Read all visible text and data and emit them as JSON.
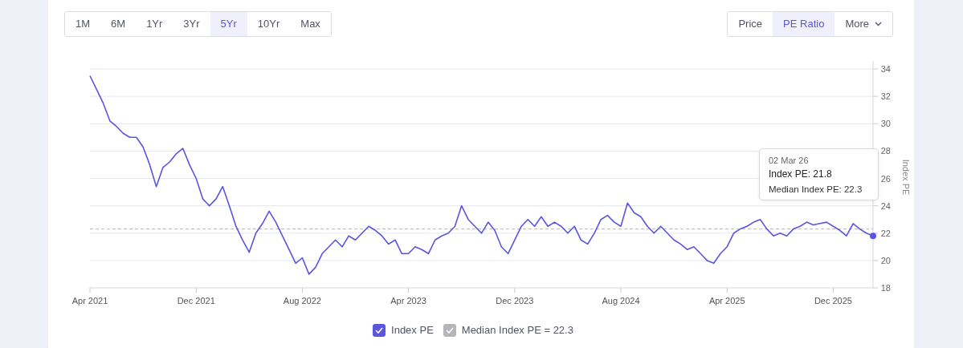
{
  "range_tabs": [
    {
      "label": "1M",
      "selected": false
    },
    {
      "label": "6M",
      "selected": false
    },
    {
      "label": "1Yr",
      "selected": false
    },
    {
      "label": "3Yr",
      "selected": false
    },
    {
      "label": "5Yr",
      "selected": true
    },
    {
      "label": "10Yr",
      "selected": false
    },
    {
      "label": "Max",
      "selected": false
    }
  ],
  "view_tabs": [
    {
      "label": "Price",
      "selected": false,
      "kind": "plain"
    },
    {
      "label": "PE Ratio",
      "selected": true,
      "kind": "plain"
    },
    {
      "label": "More",
      "selected": false,
      "kind": "dropdown"
    }
  ],
  "chart": {
    "chart_data": {
      "type": "line",
      "ylabel": "Index PE",
      "categories": [
        "Apr 2021",
        null,
        null,
        null,
        null,
        null,
        null,
        null,
        null,
        null,
        null,
        null,
        null,
        null,
        null,
        null,
        "Dec 2021",
        null,
        null,
        null,
        null,
        null,
        null,
        null,
        null,
        null,
        null,
        null,
        null,
        null,
        null,
        null,
        "Aug 2022",
        null,
        null,
        null,
        null,
        null,
        null,
        null,
        null,
        null,
        null,
        null,
        null,
        null,
        null,
        null,
        "Apr 2023",
        null,
        null,
        null,
        null,
        null,
        null,
        null,
        null,
        null,
        null,
        null,
        null,
        null,
        null,
        null,
        "Dec 2023",
        null,
        null,
        null,
        null,
        null,
        null,
        null,
        null,
        null,
        null,
        null,
        null,
        null,
        null,
        null,
        "Aug 2024",
        null,
        null,
        null,
        null,
        null,
        null,
        null,
        null,
        null,
        null,
        null,
        null,
        null,
        null,
        null,
        "Apr 2025",
        null,
        null,
        null,
        null,
        null,
        null,
        null,
        null,
        null,
        null,
        null,
        null,
        null,
        null,
        null,
        "Dec 2025",
        null,
        null,
        null,
        null,
        null,
        null
      ],
      "series": [
        {
          "name": "Index PE",
          "color": "#5b55e0",
          "values": [
            33.5,
            32.5,
            31.5,
            30.2,
            29.8,
            29.3,
            29.0,
            29.0,
            28.3,
            27.0,
            25.4,
            26.8,
            27.2,
            27.8,
            28.2,
            27.0,
            26.0,
            24.5,
            24.0,
            24.5,
            25.4,
            24.0,
            22.5,
            21.5,
            20.6,
            22.0,
            22.7,
            23.6,
            22.8,
            21.8,
            20.8,
            19.8,
            20.2,
            19.0,
            19.5,
            20.5,
            21.0,
            21.5,
            21.0,
            21.8,
            21.5,
            22.0,
            22.5,
            22.2,
            21.8,
            21.2,
            21.5,
            20.5,
            20.5,
            21.0,
            20.8,
            20.5,
            21.5,
            21.8,
            22.0,
            22.5,
            24.0,
            23.0,
            22.5,
            22.0,
            22.8,
            22.2,
            21.0,
            20.5,
            21.5,
            22.5,
            23.0,
            22.5,
            23.2,
            22.5,
            22.8,
            22.5,
            22.0,
            22.5,
            21.5,
            21.2,
            22.0,
            23.0,
            23.3,
            22.8,
            22.5,
            24.2,
            23.5,
            23.2,
            22.5,
            22.0,
            22.5,
            22.0,
            21.5,
            21.2,
            20.8,
            21.0,
            20.5,
            20.0,
            19.8,
            20.5,
            21.0,
            22.0,
            22.3,
            22.5,
            22.8,
            23.0,
            22.3,
            21.8,
            22.0,
            21.8,
            22.3,
            22.5,
            22.8,
            22.6,
            22.7,
            22.8,
            22.5,
            22.2,
            21.8,
            22.7,
            22.3,
            22.0,
            21.8
          ]
        },
        {
          "name": "Median Index PE = 22.3",
          "color": "#b4b4ba",
          "line_style": "dashed",
          "values": [
            22.3,
            22.3,
            22.3,
            22.3,
            22.3,
            22.3,
            22.3,
            22.3,
            22.3,
            22.3,
            22.3,
            22.3,
            22.3,
            22.3,
            22.3,
            22.3,
            22.3,
            22.3,
            22.3,
            22.3,
            22.3,
            22.3,
            22.3,
            22.3,
            22.3,
            22.3,
            22.3,
            22.3,
            22.3,
            22.3,
            22.3,
            22.3,
            22.3,
            22.3,
            22.3,
            22.3,
            22.3,
            22.3,
            22.3,
            22.3,
            22.3,
            22.3,
            22.3,
            22.3,
            22.3,
            22.3,
            22.3,
            22.3,
            22.3,
            22.3,
            22.3,
            22.3,
            22.3,
            22.3,
            22.3,
            22.3,
            22.3,
            22.3,
            22.3,
            22.3,
            22.3,
            22.3,
            22.3,
            22.3,
            22.3,
            22.3,
            22.3,
            22.3,
            22.3,
            22.3,
            22.3,
            22.3,
            22.3,
            22.3,
            22.3,
            22.3,
            22.3,
            22.3,
            22.3,
            22.3,
            22.3,
            22.3,
            22.3,
            22.3,
            22.3,
            22.3,
            22.3,
            22.3,
            22.3,
            22.3,
            22.3,
            22.3,
            22.3,
            22.3,
            22.3,
            22.3,
            22.3,
            22.3,
            22.3,
            22.3,
            22.3,
            22.3,
            22.3,
            22.3,
            22.3,
            22.3,
            22.3,
            22.3,
            22.3,
            22.3,
            22.3,
            22.3,
            22.3,
            22.3,
            22.3,
            22.3,
            22.3,
            22.3,
            22.3
          ]
        }
      ],
      "ylim": [
        18,
        34
      ],
      "yticks": [
        18,
        20,
        22,
        24,
        26,
        28,
        30,
        32,
        34
      ],
      "grid": true,
      "legend": "bottom"
    },
    "tooltip": {
      "date": "02 Mar 26",
      "lines": [
        {
          "text": "Index PE: 21.8",
          "kind": "primary"
        },
        {
          "text": "Median Index PE: 22.3",
          "kind": "secondary"
        }
      ]
    }
  },
  "legend": [
    {
      "checked": true
    },
    {
      "checked": true
    }
  ]
}
